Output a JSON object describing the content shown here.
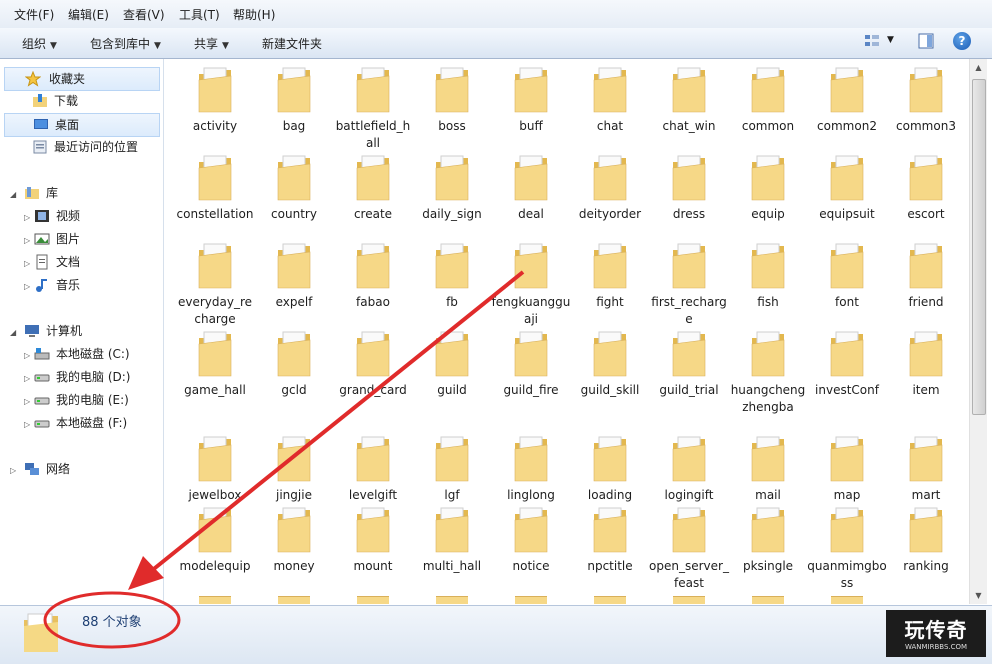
{
  "menu": [
    "文件(F)",
    "编辑(E)",
    "查看(V)",
    "工具(T)",
    "帮助(H)"
  ],
  "toolbar": {
    "organize": "组织",
    "include": "包含到库中",
    "share": "共享",
    "new_folder": "新建文件夹"
  },
  "nav": {
    "favorites": "收藏夹",
    "downloads": "下载",
    "desktop": "桌面",
    "recent": "最近访问的位置",
    "libraries": "库",
    "videos": "视频",
    "pictures": "图片",
    "documents": "文档",
    "music": "音乐",
    "computer": "计算机",
    "drives": [
      "本地磁盘 (C:)",
      "我的电脑 (D:)",
      "我的电脑 (E:)",
      "本地磁盘 (F:)"
    ],
    "network": "网络"
  },
  "folders": [
    "activity",
    "bag",
    "battlefield_hall",
    "boss",
    "buff",
    "chat",
    "chat_win",
    "common",
    "common2",
    "common3",
    "constellation",
    "country",
    "create",
    "daily_sign",
    "deal",
    "deityorder",
    "dress",
    "equip",
    "equipsuit",
    "escort",
    "everyday_recharge",
    "expelf",
    "fabao",
    "fb",
    "fengkuangguaji",
    "fight",
    "first_recharge",
    "fish",
    "font",
    "friend",
    "game_hall",
    "gcld",
    "grand_card",
    "guild",
    "guild_fire",
    "guild_skill",
    "guild_trial",
    "huangchengzhengba",
    "investConf",
    "item",
    "jewelbox",
    "jingjie",
    "levelgift",
    "lgf",
    "linglong",
    "loading",
    "logingift",
    "mail",
    "map",
    "mart",
    "modelequip",
    "money",
    "mount",
    "multi_hall",
    "notice",
    "npctitle",
    "open_server_feast",
    "pksingle",
    "quanmimgboss",
    "ranking"
  ],
  "status": {
    "count": "88 个对象"
  },
  "watermark": {
    "text": "玩传奇",
    "url": "WANMIRBBS.COM"
  },
  "colors": {
    "annotation": "#e02b2b",
    "folder": "#f2d27a",
    "accent": "#1e3f73"
  }
}
